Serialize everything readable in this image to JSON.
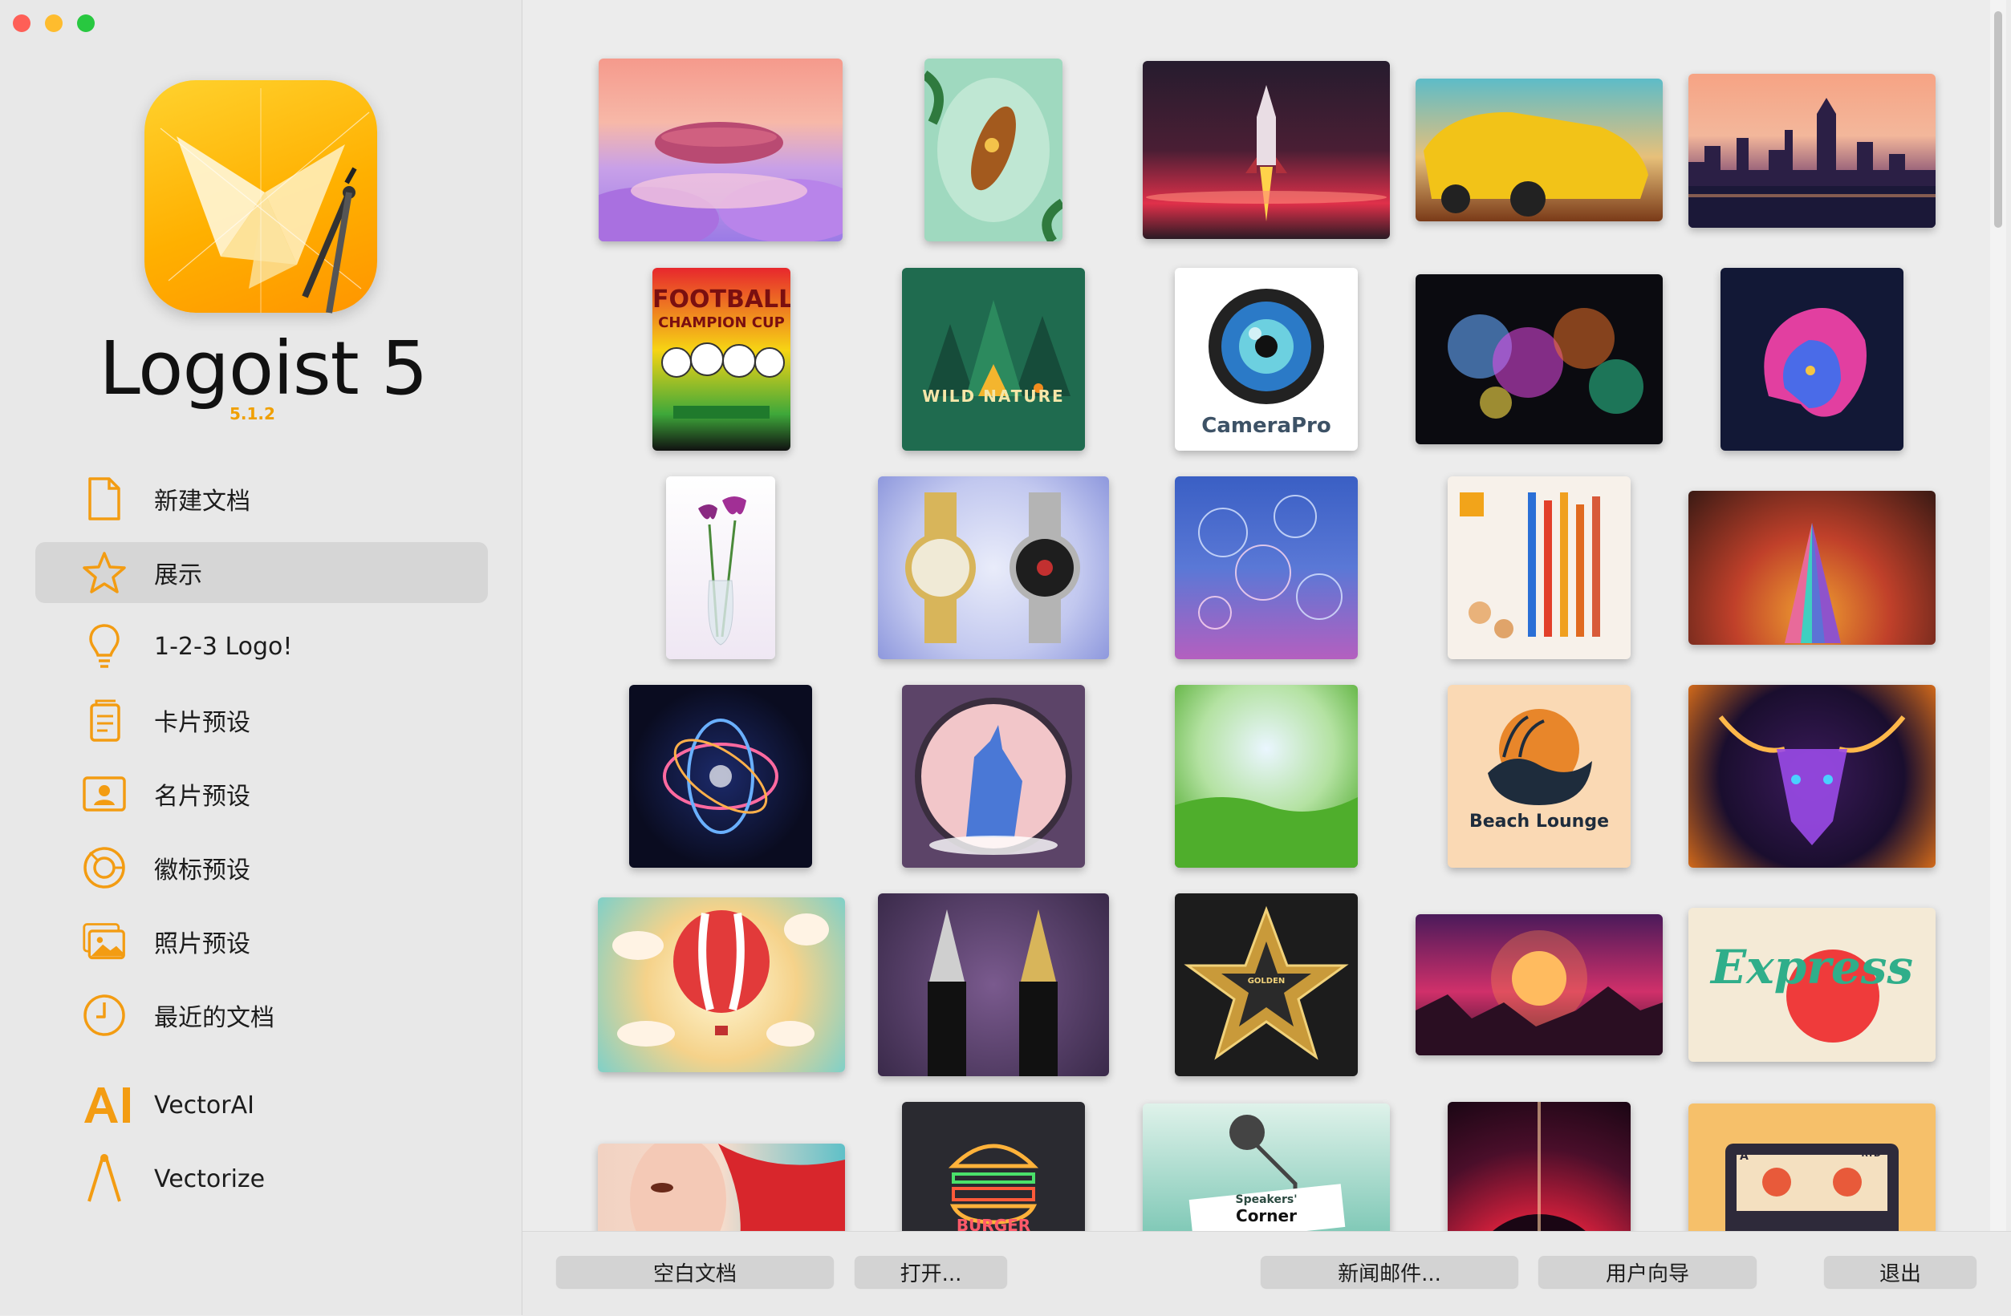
{
  "app": {
    "title": "Logoist 5",
    "version": "5.1.2"
  },
  "sidebar": {
    "items": [
      {
        "label": "新建文档",
        "icon": "document-icon"
      },
      {
        "label": "展示",
        "icon": "star-icon",
        "selected": true
      },
      {
        "label": "1-2-3 Logo!",
        "icon": "lightbulb-icon"
      },
      {
        "label": "卡片预设",
        "icon": "card-icon"
      },
      {
        "label": "名片预设",
        "icon": "contact-card-icon"
      },
      {
        "label": "徽标预设",
        "icon": "badge-icon"
      },
      {
        "label": "照片预设",
        "icon": "photos-icon"
      },
      {
        "label": "最近的文档",
        "icon": "clock-icon"
      },
      {
        "label": "VectorAI",
        "icon": "vectorai-icon"
      },
      {
        "label": "Vectorize",
        "icon": "vectorize-icon"
      }
    ]
  },
  "gallery": {
    "thumbnail_texts": {
      "football_title": "FOOTBALL",
      "football_sub": "CHAMPION CUP",
      "wild_nature": "WILD NATURE",
      "camera_pro": "CameraPro",
      "beach_lounge": "Beach Lounge",
      "golden_star": "GOLDEN",
      "express": "Express",
      "burger": "BURGER",
      "speakers": "Speakers'",
      "corner": "Corner",
      "cassette_a": "A",
      "cassette_rtd": "RTD"
    }
  },
  "bottom_bar": {
    "blank_doc": "空白文档",
    "open": "打开...",
    "newsletter": "新闻邮件...",
    "user_guide": "用户向导",
    "quit": "退出"
  },
  "colors": {
    "accent": "#f39c12",
    "sidebar_bg": "#e8e8e8",
    "selected_bg": "#d6d6d6"
  }
}
